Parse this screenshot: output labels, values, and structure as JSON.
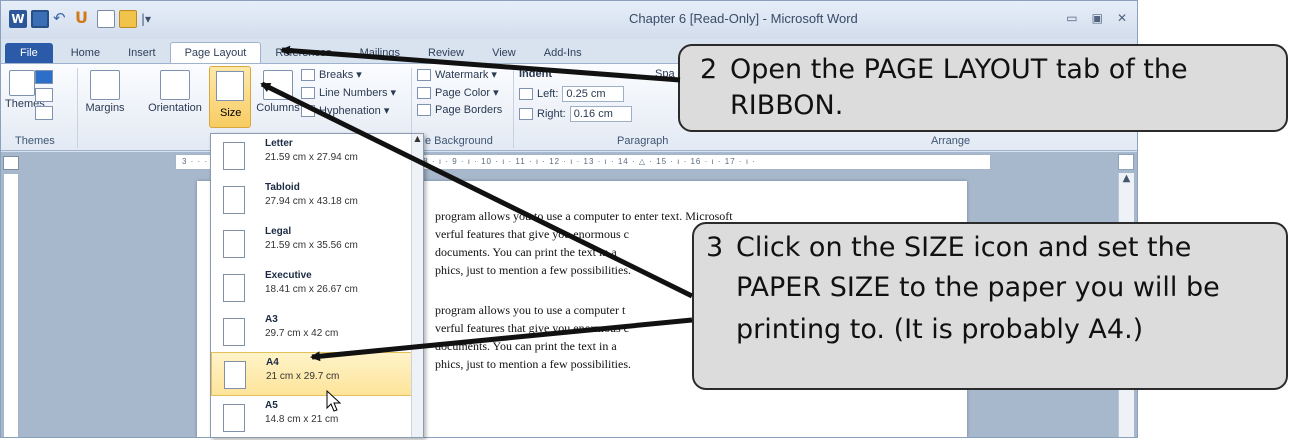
{
  "window": {
    "title": "Chapter 6 [Read-Only] - Microsoft Word"
  },
  "quick_access": {
    "app_icon": "W",
    "redo_glyph": "U"
  },
  "tabs": [
    {
      "label": "File"
    },
    {
      "label": "Home"
    },
    {
      "label": "Insert"
    },
    {
      "label": "Page Layout"
    },
    {
      "label": "References"
    },
    {
      "label": "Mailings"
    },
    {
      "label": "Review"
    },
    {
      "label": "View"
    },
    {
      "label": "Add-Ins"
    }
  ],
  "ribbon": {
    "themes": {
      "label": "Themes",
      "group": "Themes"
    },
    "margins": {
      "label": "Margins"
    },
    "orientation": {
      "label": "Orientation"
    },
    "size": {
      "label": "Size"
    },
    "columns": {
      "label": "Columns"
    },
    "breaks": {
      "label": "Breaks ▾"
    },
    "line_numbers": {
      "label": "Line Numbers ▾"
    },
    "hyphenation": {
      "label": "Hyphenation ▾"
    },
    "watermark": {
      "label": "Watermark ▾"
    },
    "page_color": {
      "label": "Page Color ▾"
    },
    "page_borders": {
      "label": "Page Borders"
    },
    "page_background_group": "e Background",
    "indent": {
      "label": "Indent",
      "left_label": "Left:",
      "left_value": "0.25 cm",
      "right_label": "Right:",
      "right_value": "0.16 cm"
    },
    "spacing_label": "Spa",
    "paragraph_group": "Paragraph",
    "arrange_group": "Arrange"
  },
  "ruler": {
    "text": "3 · · · · · · · · · · · · · · · · · 4 · ı · 5 · ı · 6 · ı · 7 · ı · 8 · ı · 9 · ı · 10 · ı · 11 · ı · 12 · ı · 13 · ı · 14 · △ · 15 · ı · 16 · ı · 17 · ı ·"
  },
  "document": {
    "lines": [
      "program allows you to use a computer to enter text. Microsoft",
      "verful features that give you enormous c",
      "documents.  You can print the text in a",
      "phics, just to mention a few possibilities.",
      "program allows you to use a computer t",
      "verful features that give you enormous c",
      "documents.  You can print the text in a",
      "phics, just to mention a few possibilities."
    ]
  },
  "paper_sizes": [
    {
      "name": "Letter",
      "dims": "21.59 cm x 27.94 cm"
    },
    {
      "name": "Tabloid",
      "dims": "27.94 cm x 43.18 cm"
    },
    {
      "name": "Legal",
      "dims": "21.59 cm x 35.56 cm"
    },
    {
      "name": "Executive",
      "dims": "18.41 cm x 26.67 cm"
    },
    {
      "name": "A3",
      "dims": "29.7 cm x 42 cm"
    },
    {
      "name": "A4",
      "dims": "21 cm x 29.7 cm",
      "selected": true
    },
    {
      "name": "A5",
      "dims": "14.8 cm x 21 cm"
    }
  ],
  "callouts": [
    {
      "num": "2",
      "line1": "Open the PAGE LAYOUT tab of the",
      "line2": "RIBBON."
    },
    {
      "num": "3",
      "line1": "Click on the SIZE icon and set the",
      "line2": "PAPER SIZE to the paper you will be",
      "line3": "printing to.  (It is probably A4.)"
    }
  ]
}
